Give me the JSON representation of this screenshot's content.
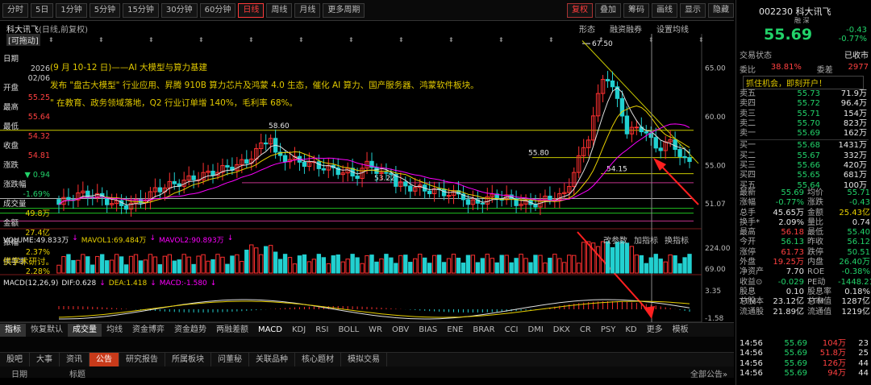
{
  "toolbar": {
    "items": [
      "分时",
      "5日",
      "1分钟",
      "5分钟",
      "15分钟",
      "30分钟",
      "60分钟",
      "日线",
      "周线",
      "月线",
      "更多周期"
    ],
    "active": "日线",
    "right": [
      "复权",
      "叠加",
      "筹码",
      "画线",
      "显示",
      "",
      "隐藏"
    ],
    "sel": "复权"
  },
  "chart": {
    "title": "科大讯飞",
    "title_suffix": "(日线,前复权)",
    "draggable": "[可拖动]",
    "menu": [
      "形态",
      "融资融券",
      "设置均线"
    ],
    "y_labels": [
      "65.00",
      "60.00",
      "55.00",
      "51.07"
    ],
    "price_marks": {
      "high": "67.50",
      "a": "58.60",
      "b": "55.80",
      "c": "54.15",
      "d": "53.22"
    },
    "x_labels": [
      "08",
      "09",
      "10",
      "11",
      "12",
      "2026"
    ],
    "date_cursor": "2026/02/06/五"
  },
  "left_panel": {
    "items": [
      {
        "label": "日期",
        "value": "2026"
      },
      {
        "label": "",
        "value": "02/06"
      },
      {
        "label": "开盘",
        "value": "55.25"
      },
      {
        "label": "最高",
        "value": "55.64"
      },
      {
        "label": "最低",
        "value": "54.32"
      },
      {
        "label": "收盘",
        "value": "54.81"
      },
      {
        "label": "涨跌",
        "value": "▼ 0.94"
      },
      {
        "label": "涨跌幅",
        "value": "-1.69%"
      },
      {
        "label": "成交量",
        "value": "49.8万"
      },
      {
        "label": "金额",
        "value": "27.4亿"
      },
      {
        "label": "振幅",
        "value": "2.37%"
      },
      {
        "label": "换手率",
        "value": "2.28%"
      }
    ]
  },
  "notes": [
    "(9 月 10-12 日)——AI 大模型与算力基建",
    "发布 \"盘古大模型\" 行业应用、昇腾 910B 算力芯片及鸿蒙 4.0 生态，催化 AI 算力、国产服务器、鸿蒙软件板块。",
    "\" 在教育、政务领域落地，Q2 行业订单增 140%，毛利率 68%。"
  ],
  "volume": {
    "label": "VOLUME:49.833万",
    "mavol1": "MAVOL1:69.484万",
    "mavol2": "MAVOL2:90.893万",
    "btns": [
      "改参数",
      "加指标",
      "换指标"
    ],
    "scale": [
      "224.00",
      "69.00"
    ],
    "side_note": "供学术研讨。"
  },
  "macd": {
    "label": "MACD(12,26,9)",
    "dif": "DIF:0.628",
    "dea": "DEA:1.418",
    "macd": "MACD:-1.580",
    "scale": [
      "3.35",
      "-1.58"
    ]
  },
  "ind_tabs": [
    "指标",
    "恢复默认",
    "成交量",
    "均线",
    "资金博弈",
    "资金趋势",
    "两融差额",
    "MACD",
    "KDJ",
    "RSI",
    "BOLL",
    "WR",
    "OBV",
    "BIAS",
    "ENE",
    "BRAR",
    "CCI",
    "DMI",
    "DKX",
    "CR",
    "PSY",
    "KD",
    "更多",
    "模板"
  ],
  "news_tabs": [
    "股吧",
    "大事",
    "资讯",
    "公告",
    "研究报告",
    "所属板块",
    "问董秘",
    "关联品种",
    "核心题材",
    "模拟交易"
  ],
  "news_active": "公告",
  "news_head": {
    "date": "日期",
    "title": "标题",
    "all": "全部公告»"
  },
  "quote": {
    "code": "002230",
    "name": "科大讯飞",
    "tags": [
      "融",
      "深"
    ],
    "price": "55.69",
    "change": "-0.43",
    "pct": "-0.77%",
    "status_label": "交易状态",
    "status": "已收市",
    "webi_label": "委比",
    "webi": "38.81%",
    "weicha_label": "委差",
    "weicha": "2977",
    "promo": "抓住机会，即刻开户！",
    "sells": [
      [
        "卖五",
        "55.73",
        "71.9万"
      ],
      [
        "卖四",
        "55.72",
        "96.4万"
      ],
      [
        "卖三",
        "55.71",
        "154万"
      ],
      [
        "卖二",
        "55.70",
        "823万"
      ],
      [
        "卖一",
        "55.69",
        "162万"
      ]
    ],
    "buys": [
      [
        "买一",
        "55.68",
        "1431万"
      ],
      [
        "买二",
        "55.67",
        "332万"
      ],
      [
        "买三",
        "55.66",
        "420万"
      ],
      [
        "买四",
        "55.65",
        "681万"
      ],
      [
        "买五",
        "55.64",
        "100万"
      ]
    ],
    "stats": [
      [
        "最新",
        "55.69",
        "均价",
        "55.71"
      ],
      [
        "涨幅",
        "-0.77%",
        "涨跌",
        "-0.43"
      ],
      [
        "总手",
        "45.65万",
        "金额",
        "25.43亿"
      ],
      [
        "换手*",
        "2.09%",
        "量比",
        "0.74"
      ],
      [
        "最高",
        "56.18",
        "最低",
        "55.40"
      ],
      [
        "今开",
        "56.13",
        "昨收",
        "56.12"
      ],
      [
        "涨停",
        "61.73",
        "跌停",
        "50.51"
      ],
      [
        "外盘",
        "19.25万",
        "内盘",
        "26.40万"
      ],
      [
        "净资产",
        "7.70",
        "ROE",
        "-0.38%"
      ],
      [
        "收益⊙",
        "-0.029",
        "PE动",
        "-1448.21"
      ],
      [
        "股息TTM",
        "0.10",
        "股息率TTM",
        "0.18%"
      ],
      [
        "总股本",
        "23.12亿",
        "总市值",
        "1287亿"
      ],
      [
        "流通股",
        "21.89亿",
        "流通值",
        "1219亿"
      ]
    ],
    "ticks": [
      [
        "14:56",
        "55.69",
        "104万",
        "23"
      ],
      [
        "14:56",
        "55.69",
        "51.8万",
        "25"
      ],
      [
        "14:56",
        "55.69",
        "126万",
        "44"
      ],
      [
        "14:56",
        "55.69",
        "94万",
        "44"
      ]
    ]
  }
}
